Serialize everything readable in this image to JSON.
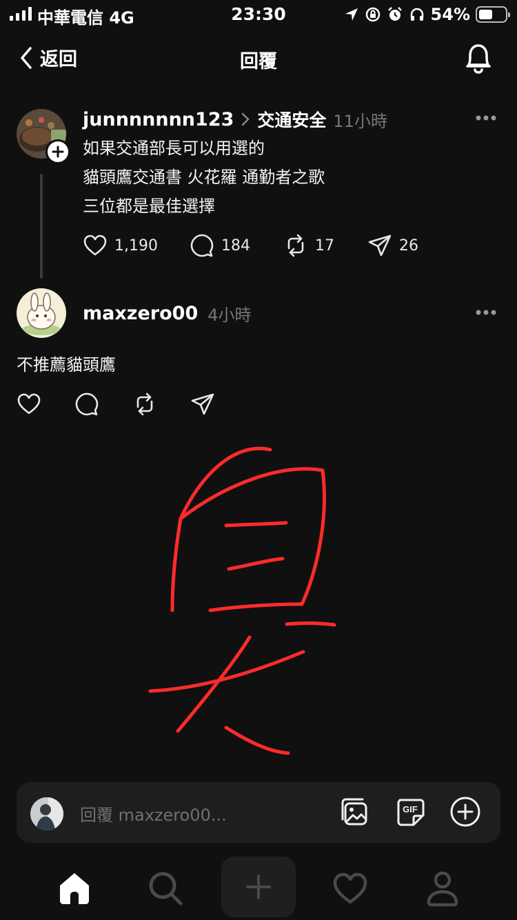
{
  "status_bar": {
    "carrier": "中華電信 4G",
    "time": "23:30",
    "battery": "54%",
    "battery_level": 0.54
  },
  "header": {
    "back_label": "返回",
    "title": "回覆"
  },
  "posts": [
    {
      "username": "junnnnnnn123",
      "topic": "交通安全",
      "time": "11小時",
      "lines": [
        "如果交通部長可以用選的",
        "貓頭鷹交通書 火花羅 通勤者之歌",
        "三位都是最佳選擇"
      ],
      "likes": "1,190",
      "comments": "184",
      "reposts": "17",
      "shares": "26"
    },
    {
      "username": "maxzero00",
      "time": "4小時",
      "lines": [
        "不推薦貓頭鷹"
      ]
    }
  ],
  "reply_bar": {
    "placeholder": "回覆 maxzero00..."
  },
  "colors": {
    "background": "#101010",
    "drawing_stroke": "#ff2b2b",
    "muted_text": "#777777"
  }
}
